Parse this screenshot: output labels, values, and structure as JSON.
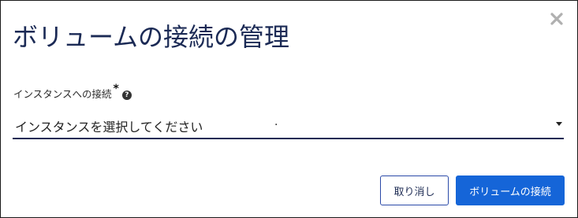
{
  "dialog": {
    "title": "ボリュームの接続の管理",
    "close_icon": "close-icon",
    "field": {
      "label": "インスタンスへの接続",
      "required_mark": "*",
      "help_icon": "help-icon",
      "help_glyph": "?",
      "value": "インスタンスを選択してください",
      "trailing_mark": ".",
      "caret_icon": "caret-down-icon"
    },
    "buttons": {
      "cancel_label": "取り消し",
      "submit_label": "ボリュームの接続"
    },
    "colors": {
      "title": "#1b2a55",
      "primary": "#1565d8",
      "underline": "#1b2a55"
    }
  }
}
